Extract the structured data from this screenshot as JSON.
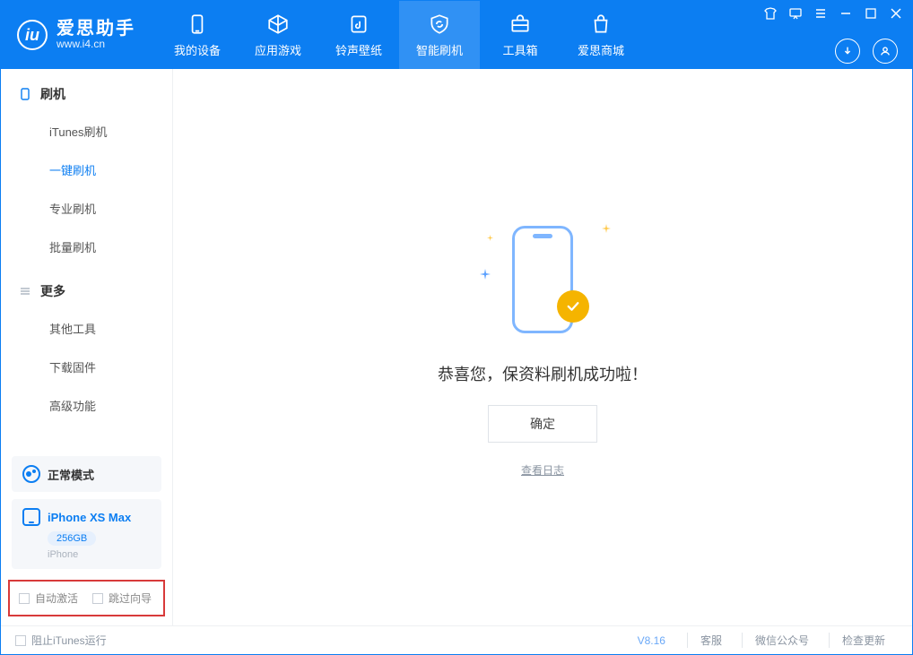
{
  "app": {
    "name": "爱思助手",
    "url": "www.i4.cn"
  },
  "tabs": {
    "t0": "我的设备",
    "t1": "应用游戏",
    "t2": "铃声壁纸",
    "t3": "智能刷机",
    "t4": "工具箱",
    "t5": "爱思商城"
  },
  "sidebar": {
    "section1": "刷机",
    "section2": "更多",
    "items": {
      "itunes": "iTunes刷机",
      "oneclick": "一键刷机",
      "pro": "专业刷机",
      "batch": "批量刷机",
      "other": "其他工具",
      "download": "下载固件",
      "advanced": "高级功能"
    },
    "mode": "正常模式",
    "device": {
      "name": "iPhone XS Max",
      "capacity": "256GB",
      "type": "iPhone"
    },
    "checks": {
      "autoActivate": "自动激活",
      "skipWizard": "跳过向导"
    }
  },
  "main": {
    "message": "恭喜您，保资料刷机成功啦！",
    "okButton": "确定",
    "viewLog": "查看日志"
  },
  "footer": {
    "blockItunes": "阻止iTunes运行",
    "version": "V8.16",
    "support": "客服",
    "wechat": "微信公众号",
    "update": "检查更新"
  }
}
